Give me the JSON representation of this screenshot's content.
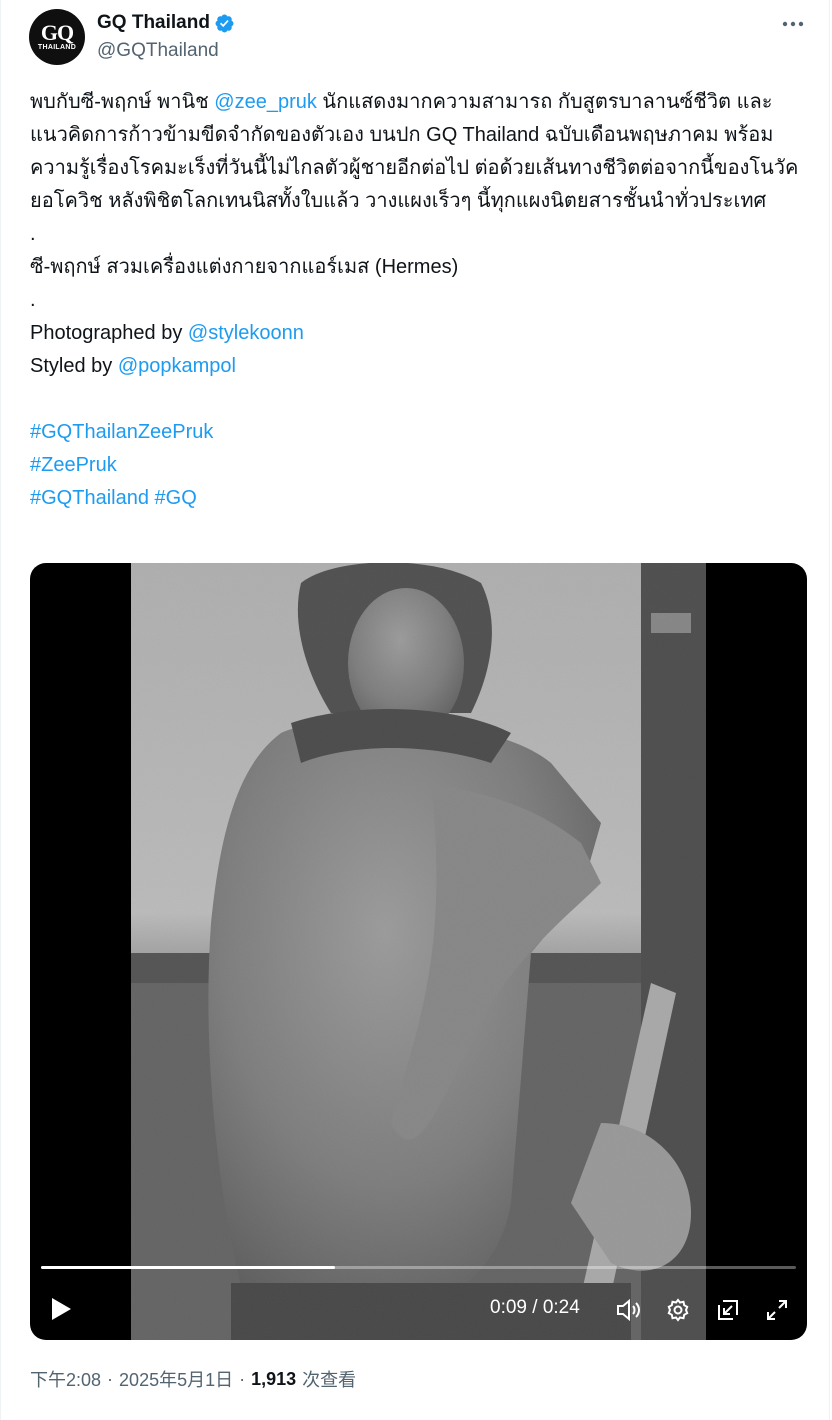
{
  "author": {
    "display_name": "GQ Thailand",
    "handle": "@GQThailand",
    "avatar_text": "GQ",
    "avatar_subtext": "THAILAND",
    "verified": true,
    "verified_color": "#1d9bf0"
  },
  "tweet": {
    "line1_a": "พบกับซี-พฤกษ์ พานิช ",
    "mention_zee": "@zee_pruk",
    "line1_b": " นักแสดงมากความสามารถ กับสูตรบาลานซ์ชีวิต และแนวคิดการก้าวข้ามขีดจำกัดของตัวเอง บนปก GQ Thailand ฉบับเดือนพฤษภาคม พร้อมความรู้เรื่องโรคมะเร็งที่วันนี้ไม่ไกลตัวผู้ชายอีกต่อไป ต่อด้วยเส้นทางชีวิตต่อจากนี้ของโนวัค ยอโควิช หลังพิชิตโลกเทนนิสทั้งใบแล้ว วางแผงเร็วๆ นี้ทุกแผงนิตยสารชั้นนำทั่วประเทศ",
    "dot1": ".",
    "line2": "ซี-พฤกษ์ สวมเครื่องแต่งกายจากแอร์เมส (Hermes)",
    "dot2": ".",
    "photographed_label": "Photographed by ",
    "photographed_mention": "@stylekoonn",
    "styled_label": "Styled by ",
    "styled_mention": "@popkampol",
    "hashtag1": "#GQThailanZeePruk",
    "hashtag2": "#ZeePruk",
    "hashtag3": "#GQThailand",
    "hashtag4": "#GQ"
  },
  "video": {
    "current_time": "0:09",
    "time_separator": " / ",
    "duration": "0:24",
    "progress": 0.39,
    "controls": [
      "play-icon",
      "volume-icon",
      "settings-gear-icon",
      "picture-in-picture-icon",
      "fullscreen-icon"
    ]
  },
  "meta": {
    "time": "下午2:08",
    "separator": "·",
    "date": "2025年5月1日",
    "views_count": "1,913",
    "views_label": "次查看"
  },
  "colors": {
    "link": "#1d9bf0",
    "text_primary": "#0f1419",
    "text_secondary": "#536471"
  }
}
